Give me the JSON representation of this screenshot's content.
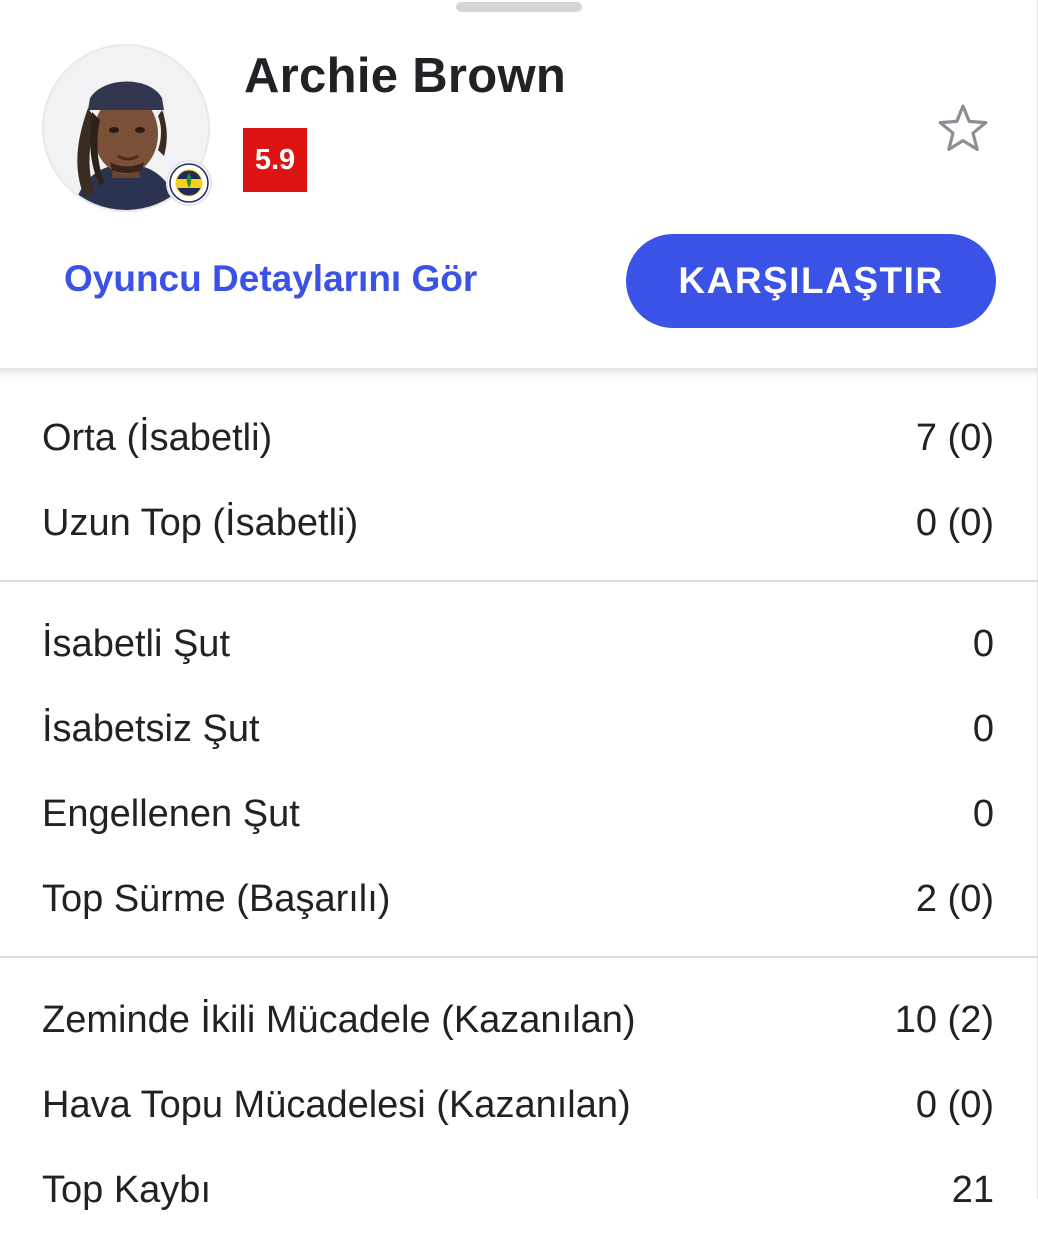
{
  "player": {
    "name": "Archie Brown",
    "rating": "5.9",
    "rating_color": "#dc1414",
    "avatar_icon": "player-photo",
    "club_icon": "fenerbahce-crest-icon"
  },
  "actions": {
    "details_link": "Oyuncu Detaylarını Gör",
    "compare_button": "KARŞILAŞTIR",
    "favorite_icon": "star-outline-icon",
    "accent_color": "#3a52e6"
  },
  "stat_groups": [
    {
      "rows": [
        {
          "label": "Orta (İsabetli)",
          "value": "7 (0)"
        },
        {
          "label": "Uzun Top (İsabetli)",
          "value": "0 (0)"
        }
      ]
    },
    {
      "rows": [
        {
          "label": "İsabetli Şut",
          "value": "0"
        },
        {
          "label": "İsabetsiz Şut",
          "value": "0"
        },
        {
          "label": "Engellenen Şut",
          "value": "0"
        },
        {
          "label": "Top Sürme (Başarılı)",
          "value": "2 (0)"
        }
      ]
    },
    {
      "rows": [
        {
          "label": "Zeminde İkili Mücadele (Kazanılan)",
          "value": "10 (2)"
        },
        {
          "label": "Hava Topu Mücadelesi (Kazanılan)",
          "value": "0 (0)"
        },
        {
          "label": "Top Kaybı",
          "value": "21"
        }
      ]
    }
  ]
}
